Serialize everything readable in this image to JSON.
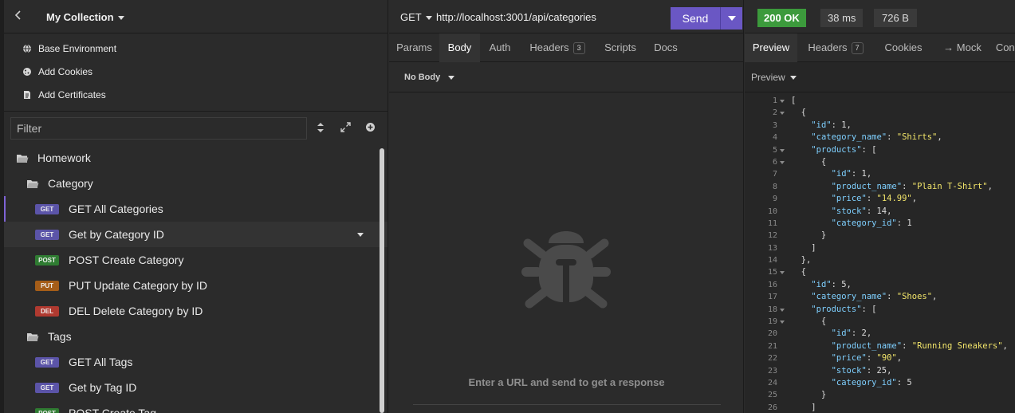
{
  "sidebar": {
    "collection_title": "My Collection",
    "actions": [
      {
        "label": "Base Environment",
        "icon": "globe-icon"
      },
      {
        "label": "Add Cookies",
        "icon": "cookie-icon"
      },
      {
        "label": "Add Certificates",
        "icon": "certificate-icon"
      }
    ],
    "filter_placeholder": "Filter",
    "tree": [
      {
        "type": "folder",
        "label": "Homework",
        "indent": 0
      },
      {
        "type": "folder",
        "label": "Category",
        "indent": 1
      },
      {
        "type": "request",
        "method": "GET",
        "label": "GET All Categories",
        "selected": true
      },
      {
        "type": "request",
        "method": "GET",
        "label": "Get by Category ID",
        "active": true
      },
      {
        "type": "request",
        "method": "POST",
        "label": "POST Create Category"
      },
      {
        "type": "request",
        "method": "PUT",
        "label": "PUT Update Category by ID"
      },
      {
        "type": "request",
        "method": "DEL",
        "label": "DEL Delete Category by ID"
      },
      {
        "type": "folder",
        "label": "Tags",
        "indent": 1
      },
      {
        "type": "request",
        "method": "GET",
        "label": "GET All Tags"
      },
      {
        "type": "request",
        "method": "GET",
        "label": "Get by Tag ID"
      },
      {
        "type": "request",
        "method": "POST",
        "label": "POST Create Tag"
      }
    ]
  },
  "request": {
    "method": "GET",
    "url": "http://localhost:3001/api/categories",
    "send_label": "Send",
    "tabs": [
      {
        "label": "Params"
      },
      {
        "label": "Body",
        "active": true
      },
      {
        "label": "Auth"
      },
      {
        "label": "Headers",
        "count": "3"
      },
      {
        "label": "Scripts"
      },
      {
        "label": "Docs"
      }
    ],
    "body_type": "No Body",
    "empty_message": "Enter a URL and send to get a response"
  },
  "response": {
    "status": "200 OK",
    "time": "38 ms",
    "size": "726 B",
    "tabs": [
      {
        "label": "Preview",
        "active": true
      },
      {
        "label": "Headers",
        "count": "7"
      },
      {
        "label": "Cookies"
      },
      {
        "label": "→ Mock"
      },
      {
        "label": "Cons"
      }
    ],
    "preview_label": "Preview",
    "lines": [
      "[",
      "  {",
      "    \"id\": 1,",
      "    \"category_name\": \"Shirts\",",
      "    \"products\": [",
      "      {",
      "        \"id\": 1,",
      "        \"product_name\": \"Plain T-Shirt\",",
      "        \"price\": \"14.99\",",
      "        \"stock\": 14,",
      "        \"category_id\": 1",
      "      }",
      "    ]",
      "  },",
      "  {",
      "    \"id\": 5,",
      "    \"category_name\": \"Shoes\",",
      "    \"products\": [",
      "      {",
      "        \"id\": 2,",
      "        \"product_name\": \"Running Sneakers\",",
      "        \"price\": \"90\",",
      "        \"stock\": 25,",
      "        \"category_id\": 5",
      "      }",
      "    ]"
    ],
    "fold_lines": [
      1,
      2,
      5,
      6,
      15,
      18,
      19
    ]
  },
  "colors": {
    "accent": "#6a57c4",
    "status_ok": "#3c9a3c",
    "json_key": "#7fd0ff",
    "json_string": "#f2e56a"
  }
}
